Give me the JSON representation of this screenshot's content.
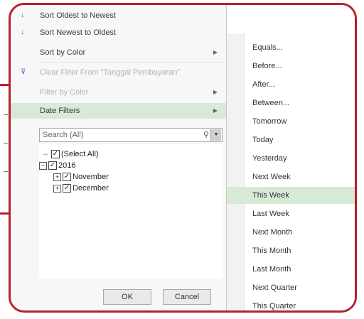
{
  "sort_menu": [
    {
      "icon": "sort-ascending-icon",
      "glyph": "↓",
      "label": "Sort Oldest to Newest",
      "disabled": false
    },
    {
      "icon": "sort-descending-icon",
      "glyph": "↓",
      "label": "Sort Newest to Oldest",
      "disabled": false
    },
    {
      "icon": "",
      "glyph": "",
      "label": "Sort by Color",
      "disabled": false,
      "submenu": true
    },
    {
      "icon": "clear-filter-icon",
      "glyph": "⊽",
      "label": "Clear Filter From \"Tanggal Pembayaran\"",
      "disabled": true
    },
    {
      "icon": "",
      "glyph": "",
      "label": "Filter by Color",
      "disabled": true,
      "submenu": true
    },
    {
      "icon": "",
      "glyph": "",
      "label": "Date Filters",
      "disabled": false,
      "submenu": true,
      "highlighted": true
    }
  ],
  "search": {
    "placeholder": "Search (All)"
  },
  "tree": {
    "select_all": "(Select All)",
    "year": "2016",
    "months": [
      "November",
      "December"
    ]
  },
  "buttons": {
    "ok": "OK",
    "cancel": "Cancel"
  },
  "date_filters": [
    "Equals...",
    "Before...",
    "After...",
    "Between...",
    "Tomorrow",
    "Today",
    "Yesterday",
    "Next Week",
    "This Week",
    "Last Week",
    "Next Month",
    "This Month",
    "Last Month",
    "Next Quarter",
    "This Quarter"
  ],
  "highlighted_filter": "This Week",
  "colors": {
    "frame": "#b8202a",
    "highlight": "#d7ead8",
    "panel": "#f7f7f7"
  }
}
